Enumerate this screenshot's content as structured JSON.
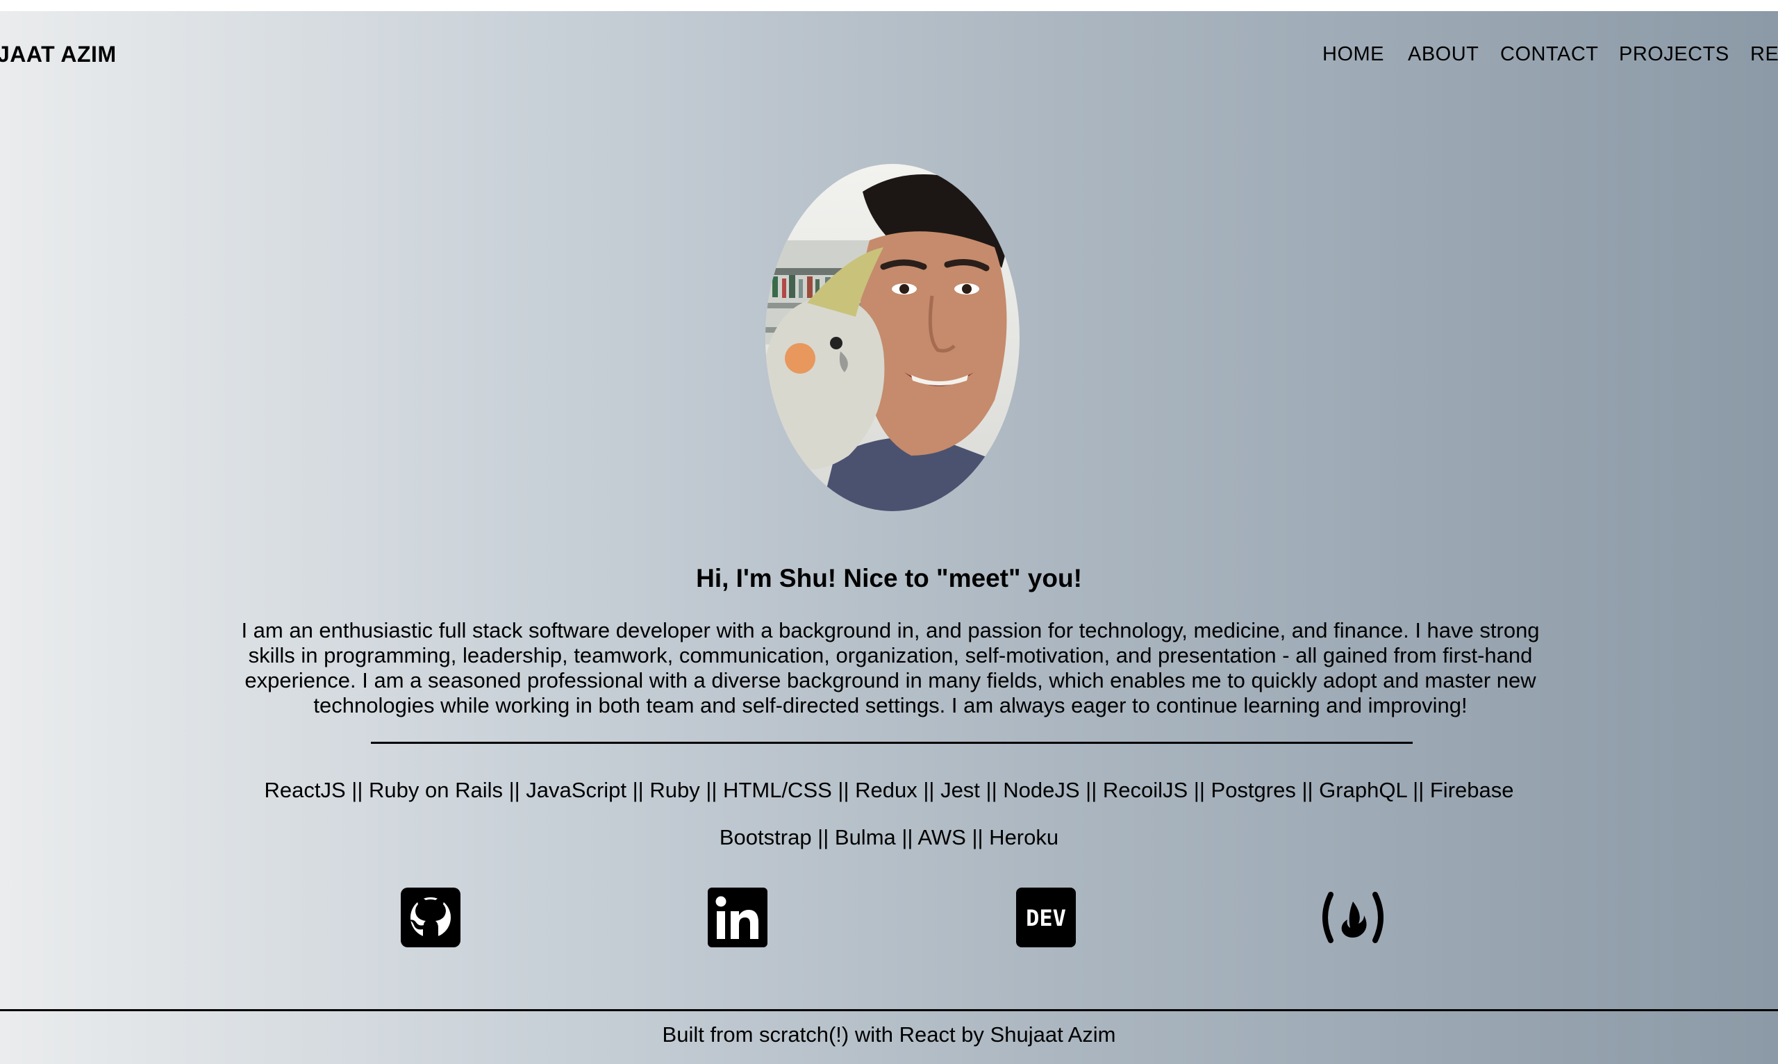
{
  "header": {
    "brand": "JAAT AZIM",
    "nav": [
      "HOME",
      "ABOUT",
      "CONTACT",
      "PROJECTS",
      "RE"
    ]
  },
  "hero": {
    "headline": "Hi, I'm Shu! Nice to \"meet\" you!",
    "bio": "I am an enthusiastic full stack software developer with a background in, and passion for technology, medicine, and finance. I have strong skills in programming, leadership, teamwork, communication, organization, self-motivation, and presentation - all gained from first-hand experience. I am a seasoned professional with a diverse background in many fields, which enables me to quickly adopt and master new technologies while working in both team and self-directed settings. I am always eager to continue learning and improving!",
    "skills_line1": "ReactJS || Ruby on Rails || JavaScript || Ruby || HTML/CSS || Redux || Jest || NodeJS || RecoilJS || Postgres || GraphQL || Firebase",
    "skills_line2": "Bootstrap || Bulma || AWS || Heroku"
  },
  "social": {
    "icons": [
      "github-icon",
      "linkedin-icon",
      "dev-icon",
      "freecodecamp-icon"
    ],
    "dev_label": "DEV"
  },
  "footer": {
    "text": "Built from scratch(!) with React by Shujaat Azim"
  },
  "colors": {
    "gradient_start": "#eaeced",
    "gradient_end": "#8c9aa7",
    "text": "#000000"
  }
}
